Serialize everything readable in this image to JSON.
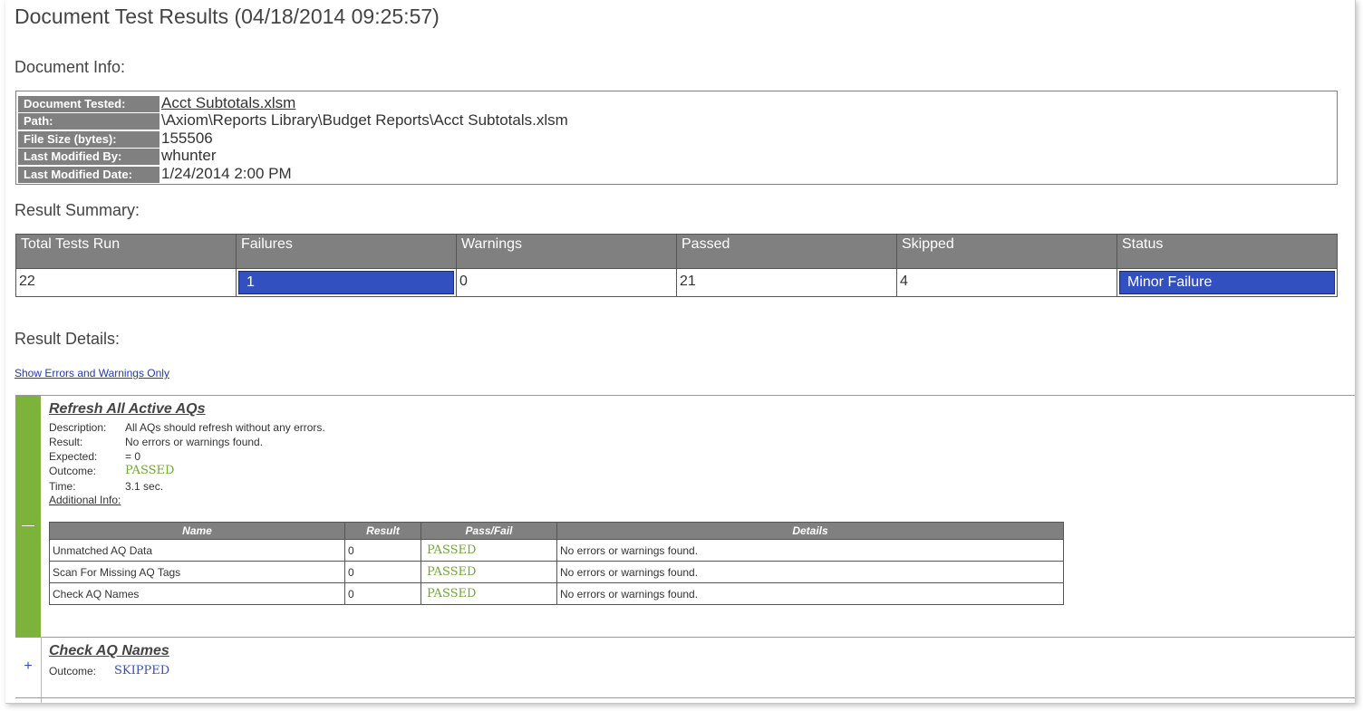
{
  "page": {
    "title": "Document Test Results (04/18/2014 09:25:57)"
  },
  "document_info": {
    "heading": "Document Info:",
    "rows": [
      {
        "label": "Document Tested:",
        "value": "Acct Subtotals.xlsm"
      },
      {
        "label": "Path:",
        "value": "\\Axiom\\Reports Library\\Budget Reports\\Acct Subtotals.xlsm"
      },
      {
        "label": "File Size (bytes):",
        "value": "155506"
      },
      {
        "label": "Last Modified By:",
        "value": "whunter"
      },
      {
        "label": "Last Modified Date:",
        "value": "1/24/2014 2:00 PM"
      }
    ]
  },
  "summary": {
    "heading": "Result Summary:",
    "headers": [
      "Total Tests Run",
      "Failures",
      "Warnings",
      "Passed",
      "Skipped",
      "Status"
    ],
    "values": [
      "22",
      "1",
      "0",
      "21",
      "4",
      "Minor Failure"
    ],
    "highlight_color": "#3350c0"
  },
  "details": {
    "heading": "Result Details:",
    "filter_link": "Show Errors and Warnings Only",
    "pass_color": "#6fa832",
    "tests": [
      {
        "title": "Refresh All Active AQs",
        "toggle": "—",
        "fields": [
          {
            "label": "Description:",
            "value": "All AQs should refresh without any errors."
          },
          {
            "label": "Result:",
            "value": "No errors or warnings found."
          },
          {
            "label": "Expected:",
            "value": "= 0"
          },
          {
            "label": "Outcome:",
            "value": "PASSED"
          },
          {
            "label": "Time:",
            "value": "3.1 sec."
          }
        ],
        "additional_info": "Additional Info:",
        "table": {
          "headers": [
            "Name",
            "Result",
            "Pass/Fail",
            "Details"
          ],
          "rows": [
            [
              "Unmatched AQ Data",
              "0",
              "PASSED",
              "No errors or warnings found."
            ],
            [
              "Scan For Missing AQ Tags",
              "0",
              "PASSED",
              "No errors or warnings found."
            ],
            [
              "Check AQ Names",
              "0",
              "PASSED",
              "No errors or warnings found."
            ]
          ]
        }
      },
      {
        "title": "Check AQ Names",
        "toggle": "+",
        "fields": [
          {
            "label": "Outcome:",
            "value": "SKIPPED"
          }
        ]
      }
    ]
  }
}
